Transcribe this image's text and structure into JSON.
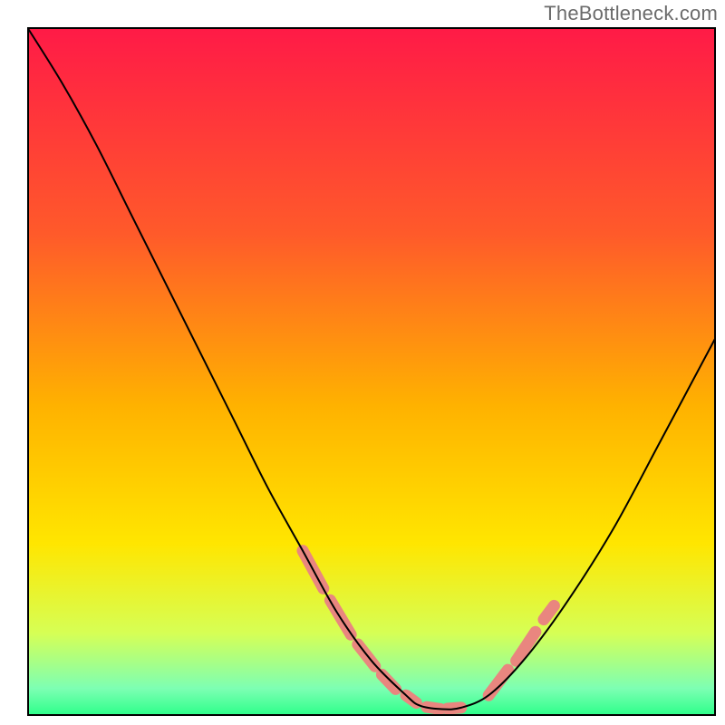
{
  "watermark": "TheBottleneck.com",
  "chart_data": {
    "type": "line",
    "title": "",
    "xlabel": "",
    "ylabel": "",
    "xlim": [
      0,
      100
    ],
    "ylim": [
      0,
      100
    ],
    "gradient_stops": [
      {
        "offset": 0,
        "color": "#ff1a47"
      },
      {
        "offset": 0.3,
        "color": "#ff5a2a"
      },
      {
        "offset": 0.55,
        "color": "#ffb200"
      },
      {
        "offset": 0.75,
        "color": "#ffe600"
      },
      {
        "offset": 0.88,
        "color": "#d6ff55"
      },
      {
        "offset": 0.96,
        "color": "#7dffb3"
      },
      {
        "offset": 1.0,
        "color": "#2bff89"
      }
    ],
    "colors": {
      "border": "#000000",
      "curve": "#000000",
      "highlight": "#e9867f"
    },
    "series": [
      {
        "name": "bottleneck-curve",
        "x": [
          0,
          5,
          10,
          15,
          20,
          25,
          30,
          35,
          40,
          45,
          50,
          55,
          57,
          60,
          63,
          67,
          72,
          78,
          85,
          92,
          100
        ],
        "y": [
          100,
          92,
          83,
          73,
          63,
          53,
          43,
          33,
          24,
          15,
          8,
          3,
          1.5,
          1,
          1.2,
          3,
          8,
          16,
          27,
          40,
          55
        ]
      }
    ],
    "highlight_segments": [
      {
        "x1": 40,
        "y1": 24,
        "x2": 43,
        "y2": 18.5
      },
      {
        "x1": 44,
        "y1": 16.8,
        "x2": 47,
        "y2": 11.8
      },
      {
        "x1": 48,
        "y1": 10.4,
        "x2": 50.5,
        "y2": 7.2
      },
      {
        "x1": 51.5,
        "y1": 6.0,
        "x2": 53.5,
        "y2": 3.9
      },
      {
        "x1": 55,
        "y1": 3.0,
        "x2": 56.5,
        "y2": 1.9
      },
      {
        "x1": 58,
        "y1": 1.3,
        "x2": 60,
        "y2": 1.0
      },
      {
        "x1": 61,
        "y1": 1.05,
        "x2": 63,
        "y2": 1.2
      },
      {
        "x1": 67,
        "y1": 3.0,
        "x2": 69.8,
        "y2": 6.7
      },
      {
        "x1": 71,
        "y1": 8.0,
        "x2": 73.8,
        "y2": 12.2
      },
      {
        "x1": 75,
        "y1": 14.0,
        "x2": 76.5,
        "y2": 16.0
      }
    ]
  }
}
